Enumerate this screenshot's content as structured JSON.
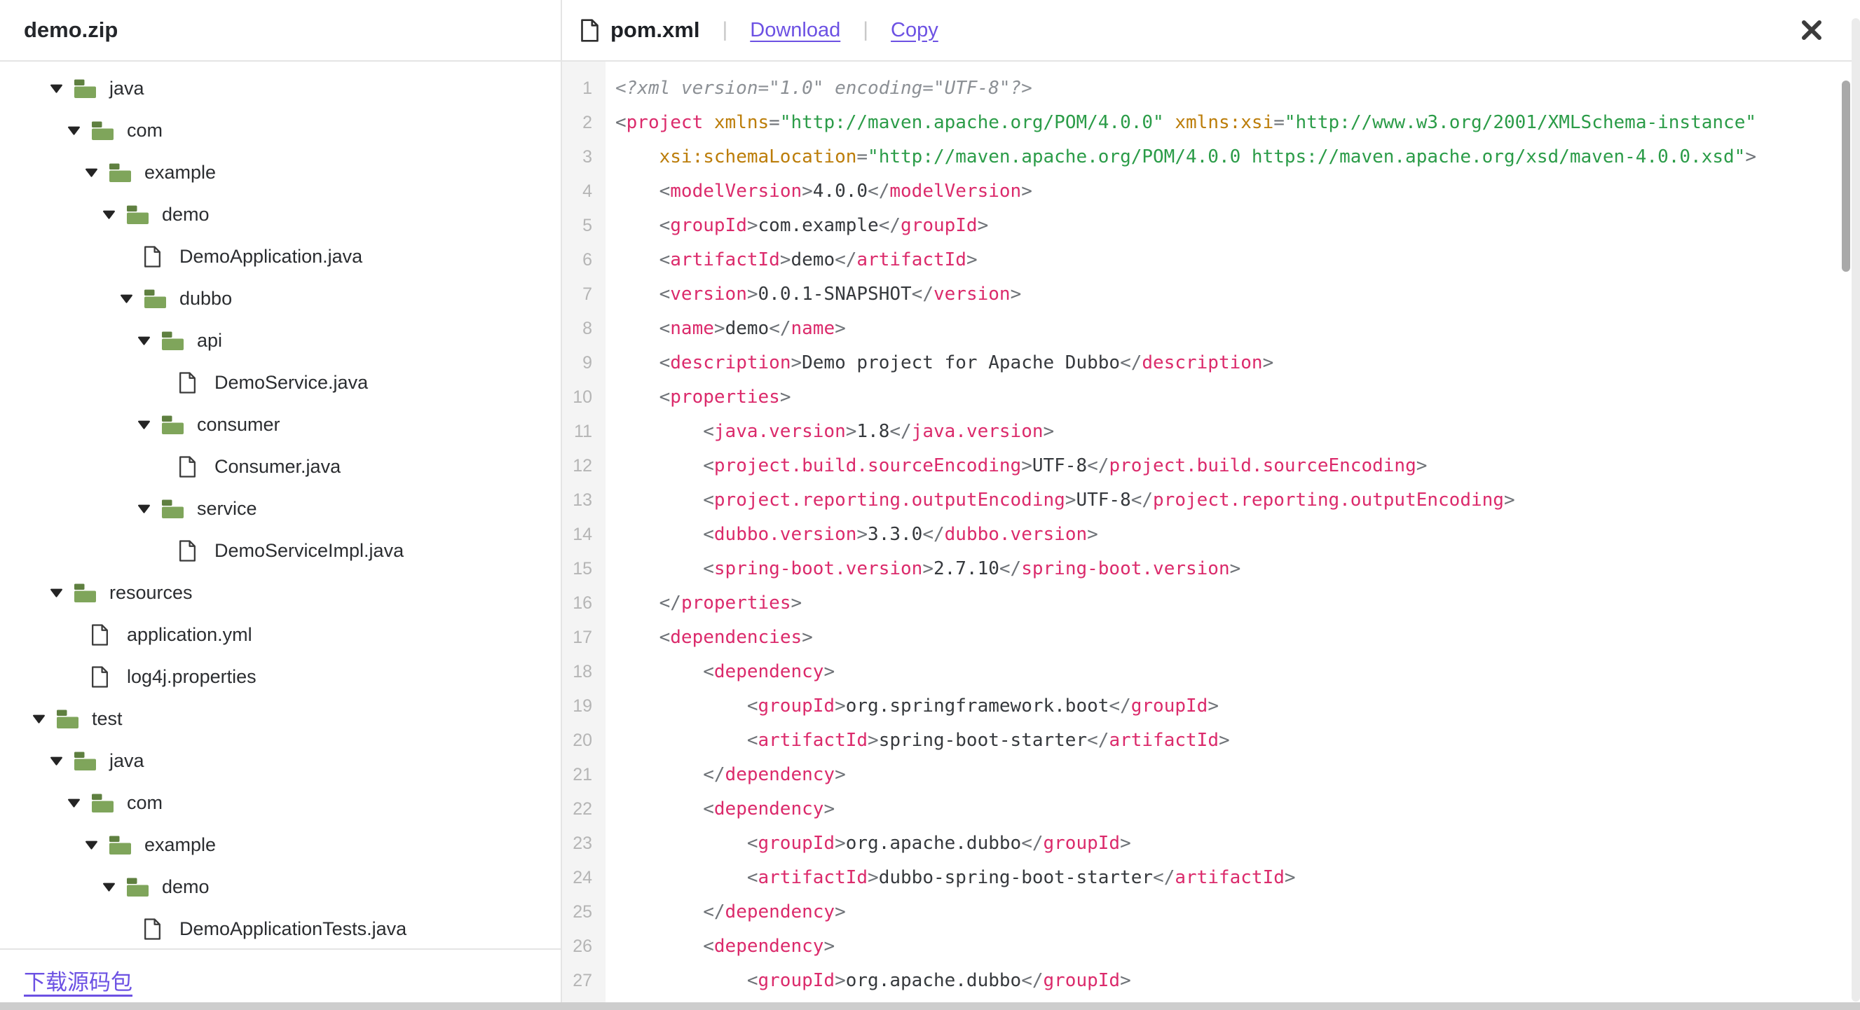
{
  "colors": {
    "accent_link": "#6C51E3",
    "folder_green": "#7FA55B",
    "folder_tab_green": "#5F8040",
    "code_tag": "#DB2A6B",
    "code_attr": "#BC7D09",
    "code_string": "#2B9C48",
    "code_punctuation": "#6E7277",
    "code_text": "#36393D",
    "code_comment": "#8C9095",
    "line_number_gray": "#B5B5B5"
  },
  "header": {
    "archive_name": "demo.zip",
    "file_name": "pom.xml",
    "divider": "|",
    "actions": {
      "download": "Download",
      "copy": "Copy"
    }
  },
  "sidebar": {
    "tree": [
      {
        "label": "java",
        "type": "folder",
        "level": 1,
        "expanded": true
      },
      {
        "label": "com",
        "type": "folder",
        "level": 2,
        "expanded": true
      },
      {
        "label": "example",
        "type": "folder",
        "level": 3,
        "expanded": true
      },
      {
        "label": "demo",
        "type": "folder",
        "level": 4,
        "expanded": true
      },
      {
        "label": "DemoApplication.java",
        "type": "file",
        "level": 5
      },
      {
        "label": "dubbo",
        "type": "folder",
        "level": 5,
        "expanded": true
      },
      {
        "label": "api",
        "type": "folder",
        "level": 6,
        "expanded": true
      },
      {
        "label": "DemoService.java",
        "type": "file",
        "level": 7
      },
      {
        "label": "consumer",
        "type": "folder",
        "level": 6,
        "expanded": true
      },
      {
        "label": "Consumer.java",
        "type": "file",
        "level": 7
      },
      {
        "label": "service",
        "type": "folder",
        "level": 6,
        "expanded": true
      },
      {
        "label": "DemoServiceImpl.java",
        "type": "file",
        "level": 7
      },
      {
        "label": "resources",
        "type": "folder",
        "level": 1,
        "expanded": true
      },
      {
        "label": "application.yml",
        "type": "file",
        "level": 2
      },
      {
        "label": "log4j.properties",
        "type": "file",
        "level": 2
      },
      {
        "label": "test",
        "type": "folder",
        "level": 0,
        "expanded": true
      },
      {
        "label": "java",
        "type": "folder",
        "level": 1,
        "expanded": true
      },
      {
        "label": "com",
        "type": "folder",
        "level": 2,
        "expanded": true
      },
      {
        "label": "example",
        "type": "folder",
        "level": 3,
        "expanded": true
      },
      {
        "label": "demo",
        "type": "folder",
        "level": 4,
        "expanded": true
      },
      {
        "label": "DemoApplicationTests.java",
        "type": "file",
        "level": 5
      }
    ],
    "footer": {
      "download_source_label": "下载源码包"
    }
  },
  "code": {
    "language": "xml",
    "lines": [
      {
        "num": 1,
        "tokens": [
          [
            "c",
            "<?xml version=\"1.0\" encoding=\"UTF-8\"?>"
          ]
        ]
      },
      {
        "num": 2,
        "tokens": [
          [
            "p",
            "<"
          ],
          [
            "t",
            "project"
          ],
          [
            "x",
            " "
          ],
          [
            "a",
            "xmlns"
          ],
          [
            "p",
            "="
          ],
          [
            "s",
            "\"http://maven.apache.org/POM/4.0.0\""
          ],
          [
            "x",
            " "
          ],
          [
            "a",
            "xmlns:xsi"
          ],
          [
            "p",
            "="
          ],
          [
            "s",
            "\"http://www.w3.org/2001/XMLSchema-instance\""
          ]
        ]
      },
      {
        "num": 3,
        "tokens": [
          [
            "x",
            "    "
          ],
          [
            "a",
            "xsi:schemaLocation"
          ],
          [
            "p",
            "="
          ],
          [
            "s",
            "\"http://maven.apache.org/POM/4.0.0 https://maven.apache.org/xsd/maven-4.0.0.xsd\""
          ],
          [
            "p",
            ">"
          ]
        ]
      },
      {
        "num": 4,
        "tokens": [
          [
            "x",
            "    "
          ],
          [
            "p",
            "<"
          ],
          [
            "t",
            "modelVersion"
          ],
          [
            "p",
            ">"
          ],
          [
            "x",
            "4.0.0"
          ],
          [
            "p",
            "</"
          ],
          [
            "t",
            "modelVersion"
          ],
          [
            "p",
            ">"
          ]
        ]
      },
      {
        "num": 5,
        "tokens": [
          [
            "x",
            "    "
          ],
          [
            "p",
            "<"
          ],
          [
            "t",
            "groupId"
          ],
          [
            "p",
            ">"
          ],
          [
            "x",
            "com.example"
          ],
          [
            "p",
            "</"
          ],
          [
            "t",
            "groupId"
          ],
          [
            "p",
            ">"
          ]
        ]
      },
      {
        "num": 6,
        "tokens": [
          [
            "x",
            "    "
          ],
          [
            "p",
            "<"
          ],
          [
            "t",
            "artifactId"
          ],
          [
            "p",
            ">"
          ],
          [
            "x",
            "demo"
          ],
          [
            "p",
            "</"
          ],
          [
            "t",
            "artifactId"
          ],
          [
            "p",
            ">"
          ]
        ]
      },
      {
        "num": 7,
        "tokens": [
          [
            "x",
            "    "
          ],
          [
            "p",
            "<"
          ],
          [
            "t",
            "version"
          ],
          [
            "p",
            ">"
          ],
          [
            "x",
            "0.0.1-SNAPSHOT"
          ],
          [
            "p",
            "</"
          ],
          [
            "t",
            "version"
          ],
          [
            "p",
            ">"
          ]
        ]
      },
      {
        "num": 8,
        "tokens": [
          [
            "x",
            "    "
          ],
          [
            "p",
            "<"
          ],
          [
            "t",
            "name"
          ],
          [
            "p",
            ">"
          ],
          [
            "x",
            "demo"
          ],
          [
            "p",
            "</"
          ],
          [
            "t",
            "name"
          ],
          [
            "p",
            ">"
          ]
        ]
      },
      {
        "num": 9,
        "tokens": [
          [
            "x",
            "    "
          ],
          [
            "p",
            "<"
          ],
          [
            "t",
            "description"
          ],
          [
            "p",
            ">"
          ],
          [
            "x",
            "Demo project for Apache Dubbo"
          ],
          [
            "p",
            "</"
          ],
          [
            "t",
            "description"
          ],
          [
            "p",
            ">"
          ]
        ]
      },
      {
        "num": 10,
        "tokens": [
          [
            "x",
            "    "
          ],
          [
            "p",
            "<"
          ],
          [
            "t",
            "properties"
          ],
          [
            "p",
            ">"
          ]
        ]
      },
      {
        "num": 11,
        "tokens": [
          [
            "x",
            "        "
          ],
          [
            "p",
            "<"
          ],
          [
            "t",
            "java.version"
          ],
          [
            "p",
            ">"
          ],
          [
            "x",
            "1.8"
          ],
          [
            "p",
            "</"
          ],
          [
            "t",
            "java.version"
          ],
          [
            "p",
            ">"
          ]
        ]
      },
      {
        "num": 12,
        "tokens": [
          [
            "x",
            "        "
          ],
          [
            "p",
            "<"
          ],
          [
            "t",
            "project.build.sourceEncoding"
          ],
          [
            "p",
            ">"
          ],
          [
            "x",
            "UTF-8"
          ],
          [
            "p",
            "</"
          ],
          [
            "t",
            "project.build.sourceEncoding"
          ],
          [
            "p",
            ">"
          ]
        ]
      },
      {
        "num": 13,
        "tokens": [
          [
            "x",
            "        "
          ],
          [
            "p",
            "<"
          ],
          [
            "t",
            "project.reporting.outputEncoding"
          ],
          [
            "p",
            ">"
          ],
          [
            "x",
            "UTF-8"
          ],
          [
            "p",
            "</"
          ],
          [
            "t",
            "project.reporting.outputEncoding"
          ],
          [
            "p",
            ">"
          ]
        ]
      },
      {
        "num": 14,
        "tokens": [
          [
            "x",
            "        "
          ],
          [
            "p",
            "<"
          ],
          [
            "t",
            "dubbo.version"
          ],
          [
            "p",
            ">"
          ],
          [
            "x",
            "3.3.0"
          ],
          [
            "p",
            "</"
          ],
          [
            "t",
            "dubbo.version"
          ],
          [
            "p",
            ">"
          ]
        ]
      },
      {
        "num": 15,
        "tokens": [
          [
            "x",
            "        "
          ],
          [
            "p",
            "<"
          ],
          [
            "t",
            "spring-boot.version"
          ],
          [
            "p",
            ">"
          ],
          [
            "x",
            "2.7.10"
          ],
          [
            "p",
            "</"
          ],
          [
            "t",
            "spring-boot.version"
          ],
          [
            "p",
            ">"
          ]
        ]
      },
      {
        "num": 16,
        "tokens": [
          [
            "x",
            "    "
          ],
          [
            "p",
            "</"
          ],
          [
            "t",
            "properties"
          ],
          [
            "p",
            ">"
          ]
        ]
      },
      {
        "num": 17,
        "tokens": [
          [
            "x",
            "    "
          ],
          [
            "p",
            "<"
          ],
          [
            "t",
            "dependencies"
          ],
          [
            "p",
            ">"
          ]
        ]
      },
      {
        "num": 18,
        "tokens": [
          [
            "x",
            "        "
          ],
          [
            "p",
            "<"
          ],
          [
            "t",
            "dependency"
          ],
          [
            "p",
            ">"
          ]
        ]
      },
      {
        "num": 19,
        "tokens": [
          [
            "x",
            "            "
          ],
          [
            "p",
            "<"
          ],
          [
            "t",
            "groupId"
          ],
          [
            "p",
            ">"
          ],
          [
            "x",
            "org.springframework.boot"
          ],
          [
            "p",
            "</"
          ],
          [
            "t",
            "groupId"
          ],
          [
            "p",
            ">"
          ]
        ]
      },
      {
        "num": 20,
        "tokens": [
          [
            "x",
            "            "
          ],
          [
            "p",
            "<"
          ],
          [
            "t",
            "artifactId"
          ],
          [
            "p",
            ">"
          ],
          [
            "x",
            "spring-boot-starter"
          ],
          [
            "p",
            "</"
          ],
          [
            "t",
            "artifactId"
          ],
          [
            "p",
            ">"
          ]
        ]
      },
      {
        "num": 21,
        "tokens": [
          [
            "x",
            "        "
          ],
          [
            "p",
            "</"
          ],
          [
            "t",
            "dependency"
          ],
          [
            "p",
            ">"
          ]
        ]
      },
      {
        "num": 22,
        "tokens": [
          [
            "x",
            "        "
          ],
          [
            "p",
            "<"
          ],
          [
            "t",
            "dependency"
          ],
          [
            "p",
            ">"
          ]
        ]
      },
      {
        "num": 23,
        "tokens": [
          [
            "x",
            "            "
          ],
          [
            "p",
            "<"
          ],
          [
            "t",
            "groupId"
          ],
          [
            "p",
            ">"
          ],
          [
            "x",
            "org.apache.dubbo"
          ],
          [
            "p",
            "</"
          ],
          [
            "t",
            "groupId"
          ],
          [
            "p",
            ">"
          ]
        ]
      },
      {
        "num": 24,
        "tokens": [
          [
            "x",
            "            "
          ],
          [
            "p",
            "<"
          ],
          [
            "t",
            "artifactId"
          ],
          [
            "p",
            ">"
          ],
          [
            "x",
            "dubbo-spring-boot-starter"
          ],
          [
            "p",
            "</"
          ],
          [
            "t",
            "artifactId"
          ],
          [
            "p",
            ">"
          ]
        ]
      },
      {
        "num": 25,
        "tokens": [
          [
            "x",
            "        "
          ],
          [
            "p",
            "</"
          ],
          [
            "t",
            "dependency"
          ],
          [
            "p",
            ">"
          ]
        ]
      },
      {
        "num": 26,
        "tokens": [
          [
            "x",
            "        "
          ],
          [
            "p",
            "<"
          ],
          [
            "t",
            "dependency"
          ],
          [
            "p",
            ">"
          ]
        ]
      },
      {
        "num": 27,
        "tokens": [
          [
            "x",
            "            "
          ],
          [
            "p",
            "<"
          ],
          [
            "t",
            "groupId"
          ],
          [
            "p",
            ">"
          ],
          [
            "x",
            "org.apache.dubbo"
          ],
          [
            "p",
            "</"
          ],
          [
            "t",
            "groupId"
          ],
          [
            "p",
            ">"
          ]
        ]
      }
    ]
  }
}
